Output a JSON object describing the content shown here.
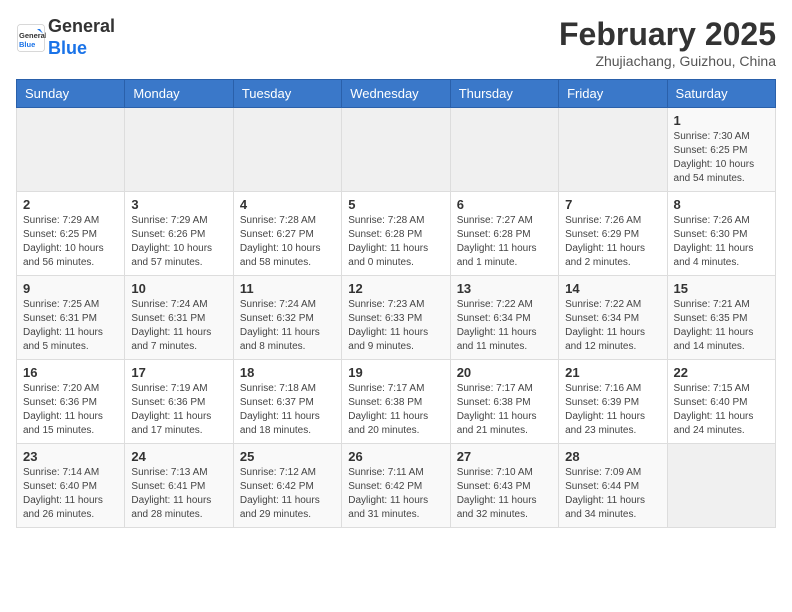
{
  "header": {
    "logo_line1": "General",
    "logo_line2": "Blue",
    "month": "February 2025",
    "location": "Zhujiachang, Guizhou, China"
  },
  "days_of_week": [
    "Sunday",
    "Monday",
    "Tuesday",
    "Wednesday",
    "Thursday",
    "Friday",
    "Saturday"
  ],
  "weeks": [
    [
      {
        "day": "",
        "info": ""
      },
      {
        "day": "",
        "info": ""
      },
      {
        "day": "",
        "info": ""
      },
      {
        "day": "",
        "info": ""
      },
      {
        "day": "",
        "info": ""
      },
      {
        "day": "",
        "info": ""
      },
      {
        "day": "1",
        "info": "Sunrise: 7:30 AM\nSunset: 6:25 PM\nDaylight: 10 hours\nand 54 minutes."
      }
    ],
    [
      {
        "day": "2",
        "info": "Sunrise: 7:29 AM\nSunset: 6:25 PM\nDaylight: 10 hours\nand 56 minutes."
      },
      {
        "day": "3",
        "info": "Sunrise: 7:29 AM\nSunset: 6:26 PM\nDaylight: 10 hours\nand 57 minutes."
      },
      {
        "day": "4",
        "info": "Sunrise: 7:28 AM\nSunset: 6:27 PM\nDaylight: 10 hours\nand 58 minutes."
      },
      {
        "day": "5",
        "info": "Sunrise: 7:28 AM\nSunset: 6:28 PM\nDaylight: 11 hours\nand 0 minutes."
      },
      {
        "day": "6",
        "info": "Sunrise: 7:27 AM\nSunset: 6:28 PM\nDaylight: 11 hours\nand 1 minute."
      },
      {
        "day": "7",
        "info": "Sunrise: 7:26 AM\nSunset: 6:29 PM\nDaylight: 11 hours\nand 2 minutes."
      },
      {
        "day": "8",
        "info": "Sunrise: 7:26 AM\nSunset: 6:30 PM\nDaylight: 11 hours\nand 4 minutes."
      }
    ],
    [
      {
        "day": "9",
        "info": "Sunrise: 7:25 AM\nSunset: 6:31 PM\nDaylight: 11 hours\nand 5 minutes."
      },
      {
        "day": "10",
        "info": "Sunrise: 7:24 AM\nSunset: 6:31 PM\nDaylight: 11 hours\nand 7 minutes."
      },
      {
        "day": "11",
        "info": "Sunrise: 7:24 AM\nSunset: 6:32 PM\nDaylight: 11 hours\nand 8 minutes."
      },
      {
        "day": "12",
        "info": "Sunrise: 7:23 AM\nSunset: 6:33 PM\nDaylight: 11 hours\nand 9 minutes."
      },
      {
        "day": "13",
        "info": "Sunrise: 7:22 AM\nSunset: 6:34 PM\nDaylight: 11 hours\nand 11 minutes."
      },
      {
        "day": "14",
        "info": "Sunrise: 7:22 AM\nSunset: 6:34 PM\nDaylight: 11 hours\nand 12 minutes."
      },
      {
        "day": "15",
        "info": "Sunrise: 7:21 AM\nSunset: 6:35 PM\nDaylight: 11 hours\nand 14 minutes."
      }
    ],
    [
      {
        "day": "16",
        "info": "Sunrise: 7:20 AM\nSunset: 6:36 PM\nDaylight: 11 hours\nand 15 minutes."
      },
      {
        "day": "17",
        "info": "Sunrise: 7:19 AM\nSunset: 6:36 PM\nDaylight: 11 hours\nand 17 minutes."
      },
      {
        "day": "18",
        "info": "Sunrise: 7:18 AM\nSunset: 6:37 PM\nDaylight: 11 hours\nand 18 minutes."
      },
      {
        "day": "19",
        "info": "Sunrise: 7:17 AM\nSunset: 6:38 PM\nDaylight: 11 hours\nand 20 minutes."
      },
      {
        "day": "20",
        "info": "Sunrise: 7:17 AM\nSunset: 6:38 PM\nDaylight: 11 hours\nand 21 minutes."
      },
      {
        "day": "21",
        "info": "Sunrise: 7:16 AM\nSunset: 6:39 PM\nDaylight: 11 hours\nand 23 minutes."
      },
      {
        "day": "22",
        "info": "Sunrise: 7:15 AM\nSunset: 6:40 PM\nDaylight: 11 hours\nand 24 minutes."
      }
    ],
    [
      {
        "day": "23",
        "info": "Sunrise: 7:14 AM\nSunset: 6:40 PM\nDaylight: 11 hours\nand 26 minutes."
      },
      {
        "day": "24",
        "info": "Sunrise: 7:13 AM\nSunset: 6:41 PM\nDaylight: 11 hours\nand 28 minutes."
      },
      {
        "day": "25",
        "info": "Sunrise: 7:12 AM\nSunset: 6:42 PM\nDaylight: 11 hours\nand 29 minutes."
      },
      {
        "day": "26",
        "info": "Sunrise: 7:11 AM\nSunset: 6:42 PM\nDaylight: 11 hours\nand 31 minutes."
      },
      {
        "day": "27",
        "info": "Sunrise: 7:10 AM\nSunset: 6:43 PM\nDaylight: 11 hours\nand 32 minutes."
      },
      {
        "day": "28",
        "info": "Sunrise: 7:09 AM\nSunset: 6:44 PM\nDaylight: 11 hours\nand 34 minutes."
      },
      {
        "day": "",
        "info": ""
      }
    ]
  ]
}
